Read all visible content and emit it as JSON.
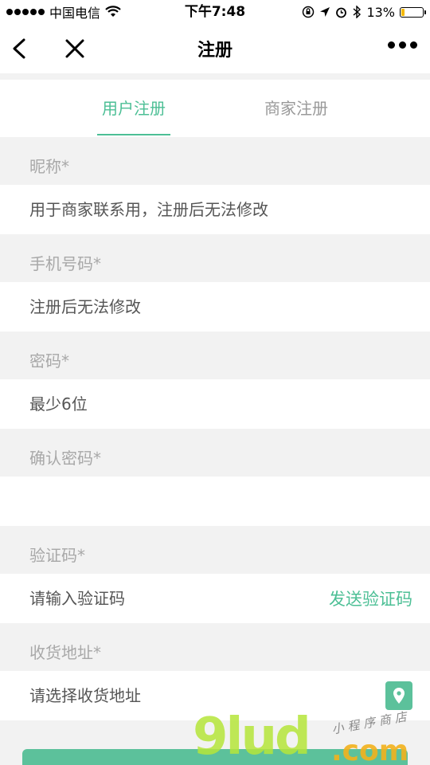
{
  "status_bar": {
    "carrier": "中国电信",
    "time": "下午7:48",
    "battery": "13%"
  },
  "nav": {
    "title": "注册"
  },
  "tabs": [
    {
      "label": "用户注册",
      "active": true
    },
    {
      "label": "商家注册",
      "active": false
    }
  ],
  "form": {
    "nickname": {
      "label": "昵称*",
      "placeholder": "用于商家联系用，注册后无法修改"
    },
    "phone": {
      "label": "手机号码*",
      "placeholder": "注册后无法修改"
    },
    "password": {
      "label": "密码*",
      "placeholder": "最少6位"
    },
    "confirm_password": {
      "label": "确认密码*",
      "placeholder": ""
    },
    "code": {
      "label": "验证码*",
      "placeholder": "请输入验证码",
      "send_label": "发送验证码"
    },
    "address": {
      "label": "收货地址*",
      "placeholder": "请选择收货地址",
      "icon": "location-pin-icon"
    }
  },
  "watermark": {
    "main": "9lud",
    "domain": ".com",
    "sub": "小程序商店"
  },
  "colors": {
    "accent": "#4cbf95",
    "background": "#f2f2f2"
  }
}
